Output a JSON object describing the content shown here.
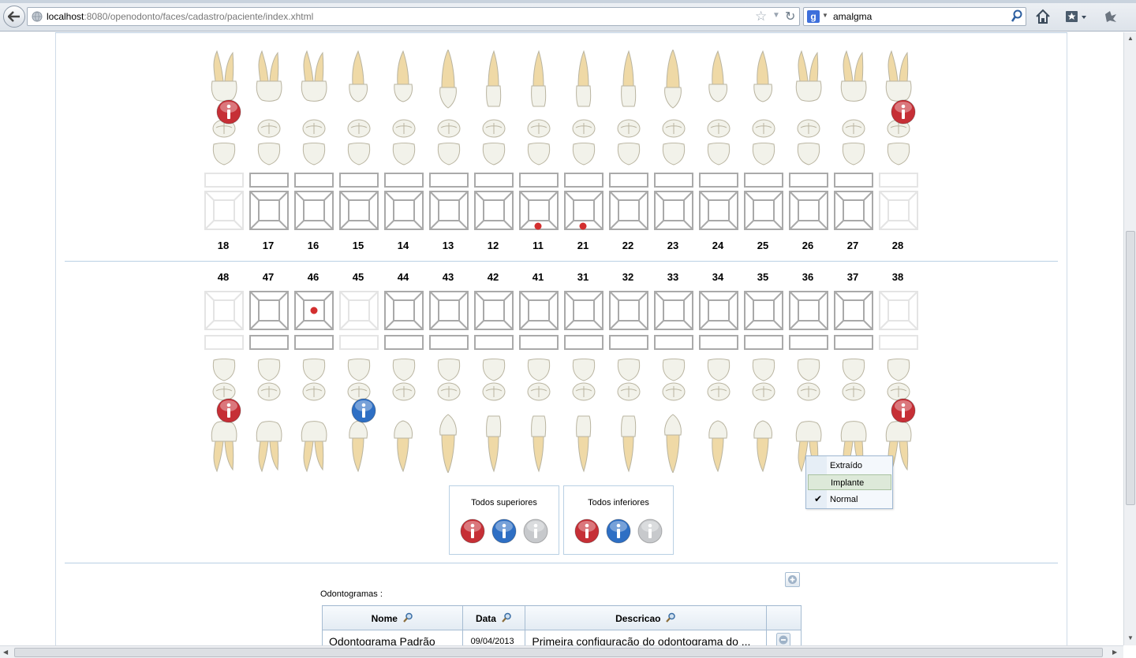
{
  "browser": {
    "url_host": "localhost",
    "url_rest": ":8080/openodonto/faces/cadastro/paciente/index.xhtml",
    "search_engine": "g",
    "search_query": "amalgma"
  },
  "upper_teeth": [
    {
      "num": "18",
      "type": "molar",
      "dim": true,
      "info": "red"
    },
    {
      "num": "17",
      "type": "molar"
    },
    {
      "num": "16",
      "type": "molar"
    },
    {
      "num": "15",
      "type": "premolar"
    },
    {
      "num": "14",
      "type": "premolar"
    },
    {
      "num": "13",
      "type": "canine"
    },
    {
      "num": "12",
      "type": "incisor"
    },
    {
      "num": "11",
      "type": "incisor",
      "dot": true
    },
    {
      "num": "21",
      "type": "incisor",
      "dot": true
    },
    {
      "num": "22",
      "type": "incisor"
    },
    {
      "num": "23",
      "type": "canine"
    },
    {
      "num": "24",
      "type": "premolar"
    },
    {
      "num": "25",
      "type": "premolar"
    },
    {
      "num": "26",
      "type": "molar"
    },
    {
      "num": "27",
      "type": "molar"
    },
    {
      "num": "28",
      "type": "molar",
      "dim": true,
      "info": "red"
    }
  ],
  "lower_teeth": [
    {
      "num": "48",
      "type": "molar",
      "dim": true,
      "info": "red"
    },
    {
      "num": "47",
      "type": "molar"
    },
    {
      "num": "46",
      "type": "molar",
      "dot": true
    },
    {
      "num": "45",
      "type": "premolar",
      "dim": true,
      "info": "blue"
    },
    {
      "num": "44",
      "type": "premolar"
    },
    {
      "num": "43",
      "type": "canine"
    },
    {
      "num": "42",
      "type": "incisor"
    },
    {
      "num": "41",
      "type": "incisor"
    },
    {
      "num": "31",
      "type": "incisor"
    },
    {
      "num": "32",
      "type": "incisor"
    },
    {
      "num": "33",
      "type": "canine"
    },
    {
      "num": "34",
      "type": "premolar"
    },
    {
      "num": "35",
      "type": "premolar"
    },
    {
      "num": "36",
      "type": "molar"
    },
    {
      "num": "37",
      "type": "molar"
    },
    {
      "num": "38",
      "type": "molar",
      "dim": true,
      "info": "red"
    }
  ],
  "context_menu": {
    "items": [
      {
        "label": "Extraído",
        "checked": false,
        "highlight": false
      },
      {
        "label": "Implante",
        "checked": false,
        "highlight": true
      },
      {
        "label": "Normal",
        "checked": true,
        "highlight": false
      }
    ]
  },
  "groups": {
    "upper_label": "Todos superiores",
    "lower_label": "Todos inferiores"
  },
  "odontogramas": {
    "label": "Odontogramas :",
    "headers": {
      "nome": "Nome",
      "data": "Data",
      "descricao": "Descricao"
    },
    "rows": [
      {
        "nome": "Odontograma Padrão",
        "data": "09/04/2013",
        "descricao": "Primeira configuração do odontograma do ..."
      }
    ]
  },
  "colors": {
    "info_red": "#c62f36",
    "info_blue": "#2e6fc4",
    "info_gray": "#c7c9cc",
    "mark_red": "#d32f2f",
    "tooth_crown": "#f2f2ea",
    "tooth_root": "#efd9a6",
    "accent": "#b9d0e4"
  }
}
